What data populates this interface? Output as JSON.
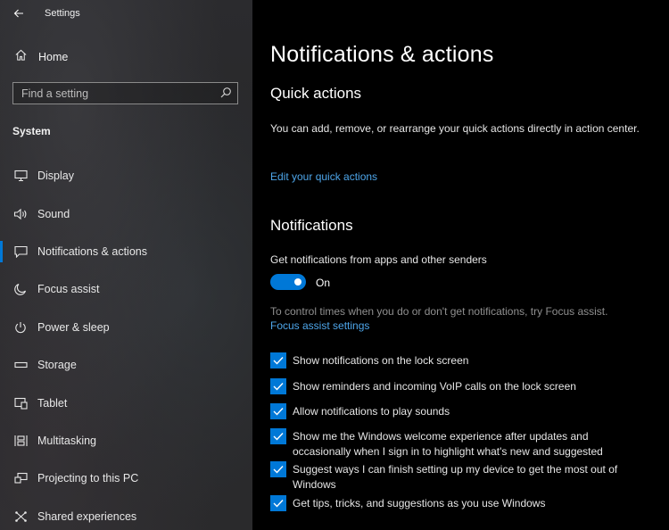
{
  "window": {
    "title": "Settings"
  },
  "sidebar": {
    "home_label": "Home",
    "search_placeholder": "Find a setting",
    "section_title": "System",
    "items": [
      {
        "label": "Display",
        "icon": "monitor-icon"
      },
      {
        "label": "Sound",
        "icon": "speaker-icon"
      },
      {
        "label": "Notifications & actions",
        "icon": "notification-icon",
        "active": true
      },
      {
        "label": "Focus assist",
        "icon": "moon-icon"
      },
      {
        "label": "Power & sleep",
        "icon": "power-icon"
      },
      {
        "label": "Storage",
        "icon": "storage-icon"
      },
      {
        "label": "Tablet",
        "icon": "tablet-icon"
      },
      {
        "label": "Multitasking",
        "icon": "multitasking-icon"
      },
      {
        "label": "Projecting to this PC",
        "icon": "projector-icon"
      },
      {
        "label": "Shared experiences",
        "icon": "shared-icon"
      }
    ]
  },
  "main": {
    "page_title": "Notifications & actions",
    "quick_actions": {
      "heading": "Quick actions",
      "description": "You can add, remove, or rearrange your quick actions directly in action center.",
      "link": "Edit your quick actions"
    },
    "notifications": {
      "heading": "Notifications",
      "toggle_caption": "Get notifications from apps and other senders",
      "toggle_state": "On",
      "focus_note": "To control times when you do or don't get notifications, try Focus assist.",
      "focus_link": "Focus assist settings",
      "options": [
        {
          "label": "Show notifications on the lock screen",
          "checked": true
        },
        {
          "label": "Show reminders and incoming VoIP calls on the lock screen",
          "checked": true
        },
        {
          "label": "Allow notifications to play sounds",
          "checked": true
        },
        {
          "label": "Show me the Windows welcome experience after updates and occasionally when I sign in to highlight what's new and suggested",
          "checked": true
        },
        {
          "label": "Suggest ways I can finish setting up my device to get the most out of Windows",
          "checked": true
        },
        {
          "label": "Get tips, tricks, and suggestions as you use Windows",
          "checked": true
        }
      ]
    }
  },
  "colors": {
    "accent": "#0078d7",
    "link": "#4ea6ea",
    "background": "#000000",
    "sidebar": "#2a2a2c"
  }
}
